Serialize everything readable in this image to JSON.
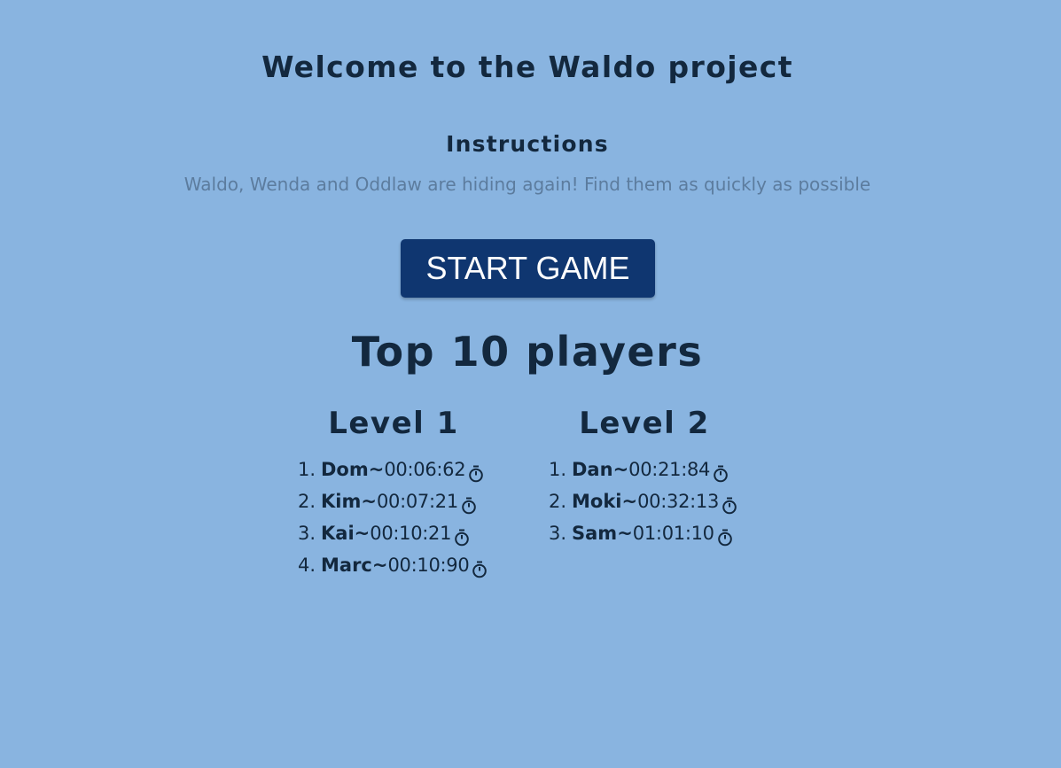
{
  "header": {
    "title": "Welcome to the Waldo project"
  },
  "instructions": {
    "heading": "Instructions",
    "text": "Waldo, Wenda and Oddlaw are hiding again! Find them as quickly as possible"
  },
  "start_button": {
    "label": "START GAME"
  },
  "leaderboard": {
    "title": "Top 10 players",
    "levels": [
      {
        "heading": "Level 1",
        "entries": [
          {
            "rank": "1.",
            "name": "Dom",
            "separator": "~",
            "time": "00:06:62"
          },
          {
            "rank": "2.",
            "name": "Kim",
            "separator": "~",
            "time": "00:07:21"
          },
          {
            "rank": "3.",
            "name": "Kai",
            "separator": "~",
            "time": "00:10:21"
          },
          {
            "rank": "4.",
            "name": "Marc",
            "separator": "~",
            "time": "00:10:90"
          }
        ]
      },
      {
        "heading": "Level 2",
        "entries": [
          {
            "rank": "1.",
            "name": "Dan",
            "separator": "~",
            "time": "00:21:84"
          },
          {
            "rank": "2.",
            "name": "Moki",
            "separator": "~",
            "time": "00:32:13"
          },
          {
            "rank": "3.",
            "name": "Sam",
            "separator": "~",
            "time": "01:01:10"
          }
        ]
      }
    ],
    "icon": "stopwatch-icon"
  },
  "colors": {
    "background": "#89b4e0",
    "text_dark": "#13283e",
    "text_muted": "#5c7c9e",
    "button_bg": "#0f3670",
    "button_text": "#ffffff"
  }
}
